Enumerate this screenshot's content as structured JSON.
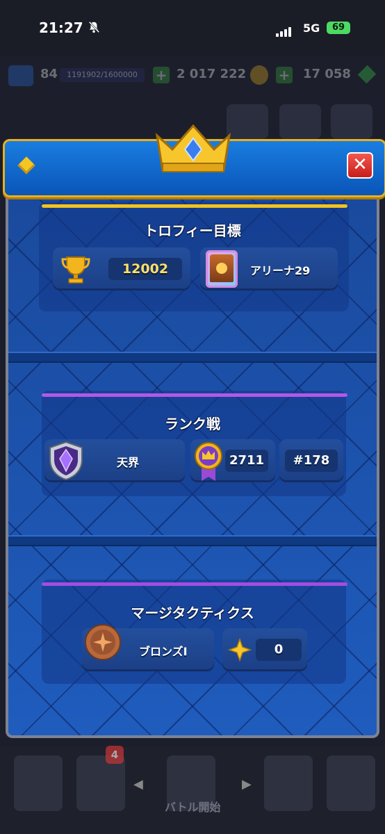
{
  "status_bar": {
    "time": "21:27",
    "network": "5G",
    "battery": "69"
  },
  "background_hud": {
    "level": "84",
    "xp": "1191902/1600000",
    "gold": "2 017 222",
    "gems": "17 058",
    "battle_label": "バトル開始",
    "cards_badge": "4"
  },
  "modal": {
    "trophy_section": {
      "title": "トロフィー目標",
      "trophies": "12002",
      "arena": "アリーナ29"
    },
    "ranked_section": {
      "title": "ランク戦",
      "league": "天界",
      "medals": "2711",
      "rank": "#178"
    },
    "merge_section": {
      "title": "マージタクティクス",
      "league": "ブロンズI",
      "stars": "0"
    }
  },
  "colors": {
    "gold_accent": "#e9b01e",
    "purple_accent": "#a24de0",
    "close_red": "#d93330",
    "panel_blue": "#1b4da4"
  }
}
